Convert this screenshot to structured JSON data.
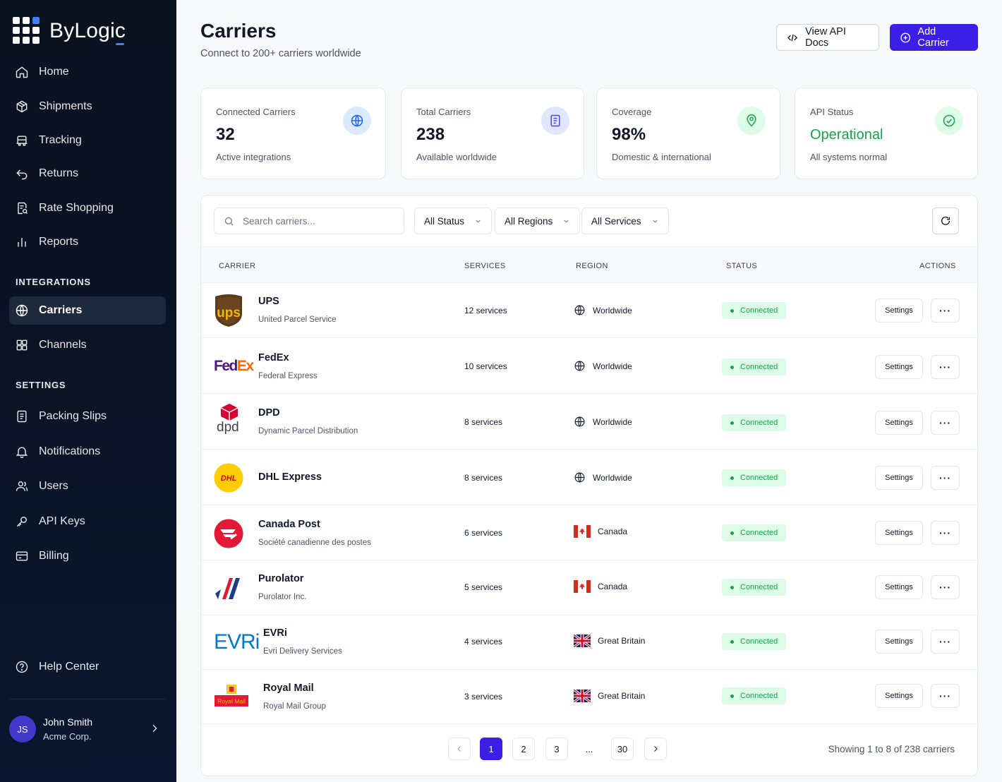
{
  "app": {
    "name": "ByLogic"
  },
  "sidebar": {
    "items": [
      {
        "label": "Home",
        "icon": "home-icon"
      },
      {
        "label": "Shipments",
        "icon": "package-icon"
      },
      {
        "label": "Tracking",
        "icon": "truck-icon"
      },
      {
        "label": "Returns",
        "icon": "return-arrow-icon"
      },
      {
        "label": "Rate Shopping",
        "icon": "receipt-search-icon"
      },
      {
        "label": "Reports",
        "icon": "bar-chart-icon"
      }
    ],
    "integrations_title": "INTEGRATIONS",
    "integrations": [
      {
        "label": "Carriers",
        "icon": "globe-icon",
        "active": true
      },
      {
        "label": "Channels",
        "icon": "grid-icon"
      }
    ],
    "settings_title": "SETTINGS",
    "settings": [
      {
        "label": "Packing Slips",
        "icon": "document-icon"
      },
      {
        "label": "Notifications",
        "icon": "bell-icon"
      },
      {
        "label": "Users",
        "icon": "users-icon"
      },
      {
        "label": "API Keys",
        "icon": "key-icon"
      },
      {
        "label": "Billing",
        "icon": "credit-card-icon"
      }
    ],
    "help": {
      "label": "Help Center",
      "icon": "help-circle-icon"
    },
    "user": {
      "initials": "JS",
      "name": "John Smith",
      "org": "Acme Corp."
    }
  },
  "header": {
    "title": "Carriers",
    "subtitle": "Connect to 200+ carriers worldwide",
    "api_docs_label": "View API Docs",
    "add_carrier_label": "Add Carrier"
  },
  "stats": [
    {
      "label": "Connected Carriers",
      "value": "32",
      "note": "Active integrations",
      "icon": "globe-icon",
      "icon_color": "#2563eb",
      "icon_bg": "#dbeafe"
    },
    {
      "label": "Total Carriers",
      "value": "238",
      "note": "Available worldwide",
      "icon": "document-icon",
      "icon_color": "#4f46e5",
      "icon_bg": "#e0e7ff"
    },
    {
      "label": "Coverage",
      "value": "98%",
      "note": "Domestic & international",
      "icon": "map-pin-icon",
      "icon_color": "#16a34a",
      "icon_bg": "#dcfce7"
    },
    {
      "label": "API Status",
      "value": "Operational",
      "note": "All systems normal",
      "icon": "check-circle-icon",
      "icon_color": "#16a34a",
      "icon_bg": "#dcfce7"
    }
  ],
  "filters": {
    "search_placeholder": "Search carriers...",
    "status": "All Status",
    "regions": "All Regions",
    "services": "All Services"
  },
  "table": {
    "columns": [
      "CARRIER",
      "SERVICES",
      "REGION",
      "STATUS",
      "ACTIONS"
    ],
    "settings_label": "Settings",
    "rows": [
      {
        "name": "UPS",
        "full": "United Parcel Service",
        "services": "12 services",
        "region": "Worldwide",
        "region_icon": "globe-icon",
        "status": "Connected"
      },
      {
        "name": "FedEx",
        "full": "Federal Express",
        "services": "10 services",
        "region": "Worldwide",
        "region_icon": "globe-icon",
        "status": "Connected"
      },
      {
        "name": "DPD",
        "full": "Dynamic Parcel Distribution",
        "services": "8 services",
        "region": "Worldwide",
        "region_icon": "globe-icon",
        "status": "Connected"
      },
      {
        "name": "DHL Express",
        "full": "",
        "services": "8 services",
        "region": "Worldwide",
        "region_icon": "globe-icon",
        "status": "Connected"
      },
      {
        "name": "Canada Post",
        "full": "Société canadienne des postes",
        "services": "6 services",
        "region": "Canada",
        "region_icon": "canada-flag-icon",
        "status": "Connected"
      },
      {
        "name": "Purolator",
        "full": "Purolator Inc.",
        "services": "5 services",
        "region": "Canada",
        "region_icon": "canada-flag-icon",
        "status": "Connected"
      },
      {
        "name": "EVRi",
        "full": "Evri Delivery Services",
        "services": "4 services",
        "region": "Great Britain",
        "region_icon": "uk-flag-icon",
        "status": "Connected"
      },
      {
        "name": "Royal Mail",
        "full": "Royal Mail Group",
        "services": "3 services",
        "region": "Great Britain",
        "region_icon": "uk-flag-icon",
        "status": "Connected"
      }
    ],
    "logos": {
      "ups": "ups",
      "fedex_fed": "Fed",
      "fedex_ex": "Ex",
      "dpd": "dpd",
      "dhl": "DHL",
      "evri": "EVRi",
      "royal_mail": "Royal Mail"
    }
  },
  "pagination": {
    "pages": [
      "1",
      "2",
      "3",
      "...",
      "30"
    ],
    "current": "1",
    "info": "Showing 1 to 8 of 238 carriers"
  },
  "colors": {
    "primary": "#3b1fe6",
    "sidebar_bg": "#0b1220",
    "success": "#16a34a",
    "success_bg": "#dcfce7"
  }
}
